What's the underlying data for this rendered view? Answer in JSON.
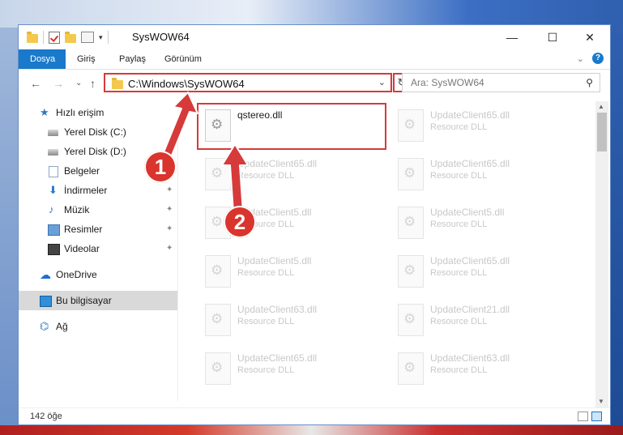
{
  "window": {
    "title": "SysWOW64",
    "minimize_glyph": "—",
    "maximize_glyph": "☐",
    "close_glyph": "✕"
  },
  "ribbon": {
    "tabs": [
      {
        "label": "Dosya",
        "active": true
      },
      {
        "label": "Giriş"
      },
      {
        "label": "Paylaş"
      },
      {
        "label": "Görünüm"
      }
    ],
    "collapse_glyph": "⌄",
    "help_glyph": "?"
  },
  "nav": {
    "back_glyph": "←",
    "forward_glyph": "→",
    "recent_glyph": "⌄",
    "up_glyph": "↑",
    "address": "C:\\Windows\\SysWOW64",
    "address_dropdown_glyph": "⌄",
    "refresh_glyph": "↻",
    "search_placeholder": "Ara: SysWOW64",
    "search_icon_glyph": "⚲"
  },
  "sidebar": {
    "items": [
      {
        "label": "Hızlı erişim",
        "icon": "star-icon"
      },
      {
        "label": "Yerel Disk (C:)",
        "icon": "drive-icon"
      },
      {
        "label": "Yerel Disk (D:)",
        "icon": "drive-icon"
      },
      {
        "label": "Belgeler",
        "icon": "documents-icon"
      },
      {
        "label": "İndirmeler",
        "icon": "downloads-icon",
        "pinned": true
      },
      {
        "label": "Müzik",
        "icon": "music-icon",
        "pinned": true
      },
      {
        "label": "Resimler",
        "icon": "pictures-icon",
        "pinned": true
      },
      {
        "label": "Videolar",
        "icon": "videos-icon",
        "pinned": true
      },
      {
        "label": "OneDrive",
        "icon": "onedrive-icon"
      },
      {
        "label": "Bu bilgisayar",
        "icon": "this-pc-icon",
        "selected": true
      },
      {
        "label": "Ağ",
        "icon": "network-icon"
      }
    ],
    "pin_glyph": "📌"
  },
  "files": [
    {
      "name": "qstereo.dll",
      "type": "",
      "highlighted": true
    },
    {
      "name": "UpdateClient65.dll",
      "type": "Resource DLL"
    },
    {
      "name": "UpdateClient65.dll",
      "type": "Resource DLL"
    },
    {
      "name": "UpdateClient65.dll",
      "type": "Resource DLL"
    },
    {
      "name": "UpdateClient5.dll",
      "type": "Resource DLL"
    },
    {
      "name": "UpdateClient5.dll",
      "type": "Resource DLL"
    },
    {
      "name": "UpdateClient5.dll",
      "type": "Resource DLL"
    },
    {
      "name": "UpdateClient65.dll",
      "type": "Resource DLL"
    },
    {
      "name": "UpdateClient63.dll",
      "type": "Resource DLL"
    },
    {
      "name": "UpdateClient21.dll",
      "type": "Resource DLL"
    },
    {
      "name": "UpdateClient65.dll",
      "type": "Resource DLL"
    },
    {
      "name": "UpdateClient63.dll",
      "type": "Resource DLL"
    }
  ],
  "status": {
    "item_count": "142 öğe"
  },
  "annotations": {
    "badge1": "1",
    "badge2": "2",
    "accent": "#d63a3a"
  }
}
